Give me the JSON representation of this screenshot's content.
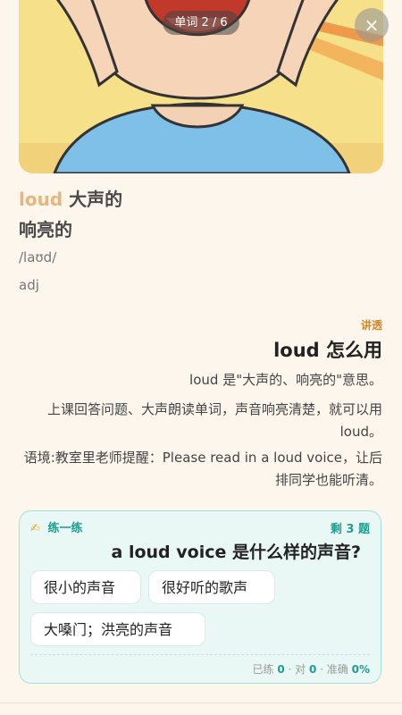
{
  "header": {
    "counter": "单词 2 / 6",
    "close_icon": "×"
  },
  "word": {
    "term": "loud",
    "meaning_1": "大声的",
    "meaning_2": "响亮的",
    "phonetic": "/laʊd/",
    "pos": "adj"
  },
  "usage": {
    "tag": "讲透",
    "title": "loud 怎么用",
    "paragraphs": [
      "loud 是\"大声的、响亮的\"意思。",
      "上课回答问题、大声朗读单词，声音响亮清楚，就可以用 loud。",
      "语境:教室里老师提醒：Please read in a loud voice，让后排同学也能听清。"
    ]
  },
  "practice": {
    "icon": "✍",
    "label": "练一练",
    "remaining": "剩 3 题",
    "question": "a loud voice 是什么样的声音?",
    "options": [
      "很小的声音",
      "很好听的歌声",
      "大嗓门；洪亮的声音"
    ],
    "stats": {
      "done_label": "已练",
      "done": "0",
      "correct_label": "对",
      "correct": "0",
      "accuracy_label": "准确",
      "accuracy": "0%"
    }
  }
}
